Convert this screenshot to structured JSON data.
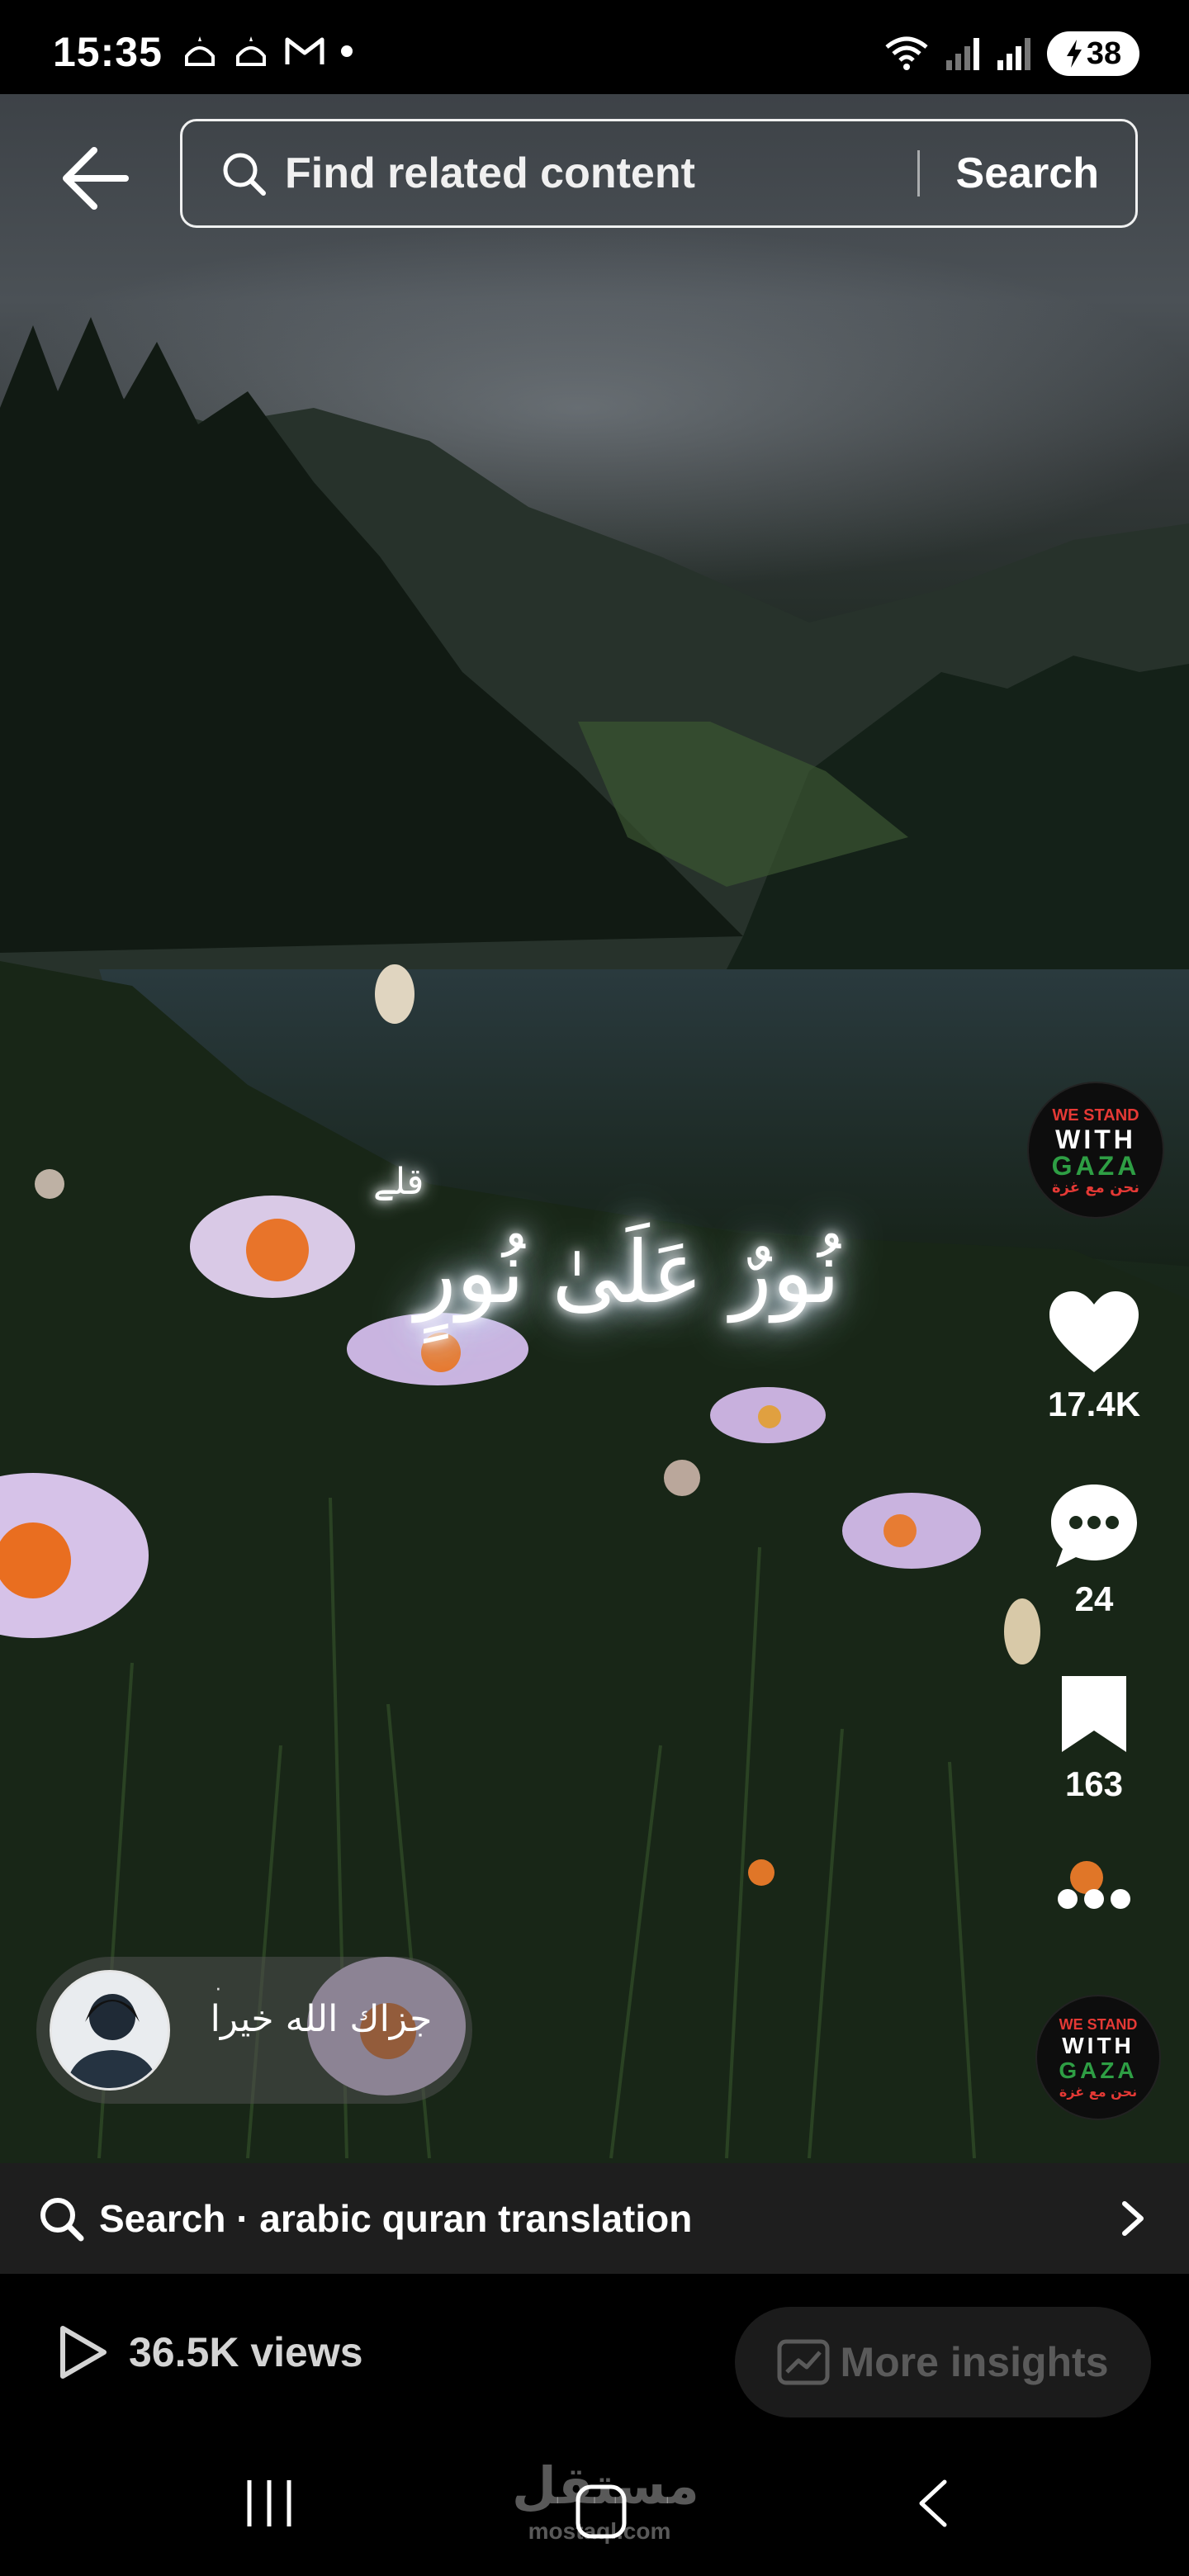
{
  "status_bar": {
    "time": "15:35",
    "battery": "38",
    "notification_icons": [
      "mosque-icon",
      "mosque-icon",
      "gmail-icon",
      "dot-icon"
    ],
    "system_icons": [
      "wifi-icon",
      "signal-icon",
      "signal-icon",
      "battery-charging-icon"
    ]
  },
  "top_bar": {
    "search_placeholder": "Find related content",
    "search_button": "Search"
  },
  "video": {
    "verse_small": "قلے",
    "verse": "نُورٌ عَلَىٰ نُورٍ"
  },
  "rail": {
    "creator_badge": {
      "line1": "WE STAND",
      "line2": "WITH",
      "line3": "GAZA",
      "line4": "نحن مع غزة"
    },
    "likes": "17.4K",
    "comments": "24",
    "saves": "163",
    "sound_badge": {
      "line1": "WE STAND",
      "line2": "WITH",
      "line3": "GAZA",
      "line4": "نحن مع غزة"
    }
  },
  "comment": {
    "dot": "·",
    "text": "جزاك الله خيرا"
  },
  "bottom_search": {
    "text": "Search · arabic quran translation"
  },
  "footer": {
    "views": "36.5K views",
    "insights": "More insights"
  },
  "watermark": {
    "main": "مستقل",
    "sub": "mostaql.com"
  },
  "colors": {
    "accent_red": "#e53935",
    "accent_green": "#2e9e44",
    "background": "#000000"
  }
}
